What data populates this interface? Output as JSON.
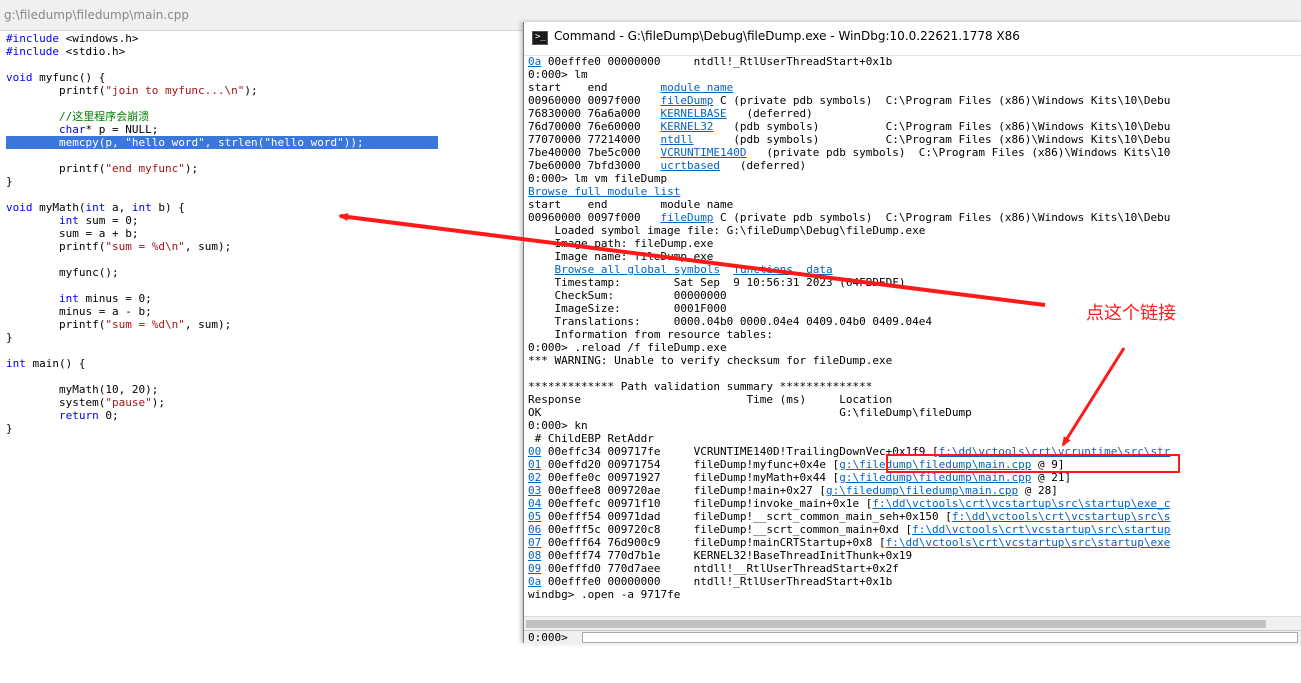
{
  "editor": {
    "title": "g:\\filedump\\filedump\\main.cpp"
  },
  "windbg": {
    "title": "Command - G:\\fileDump\\Debug\\fileDump.exe - WinDbg:10.0.22621.1778 X86",
    "command_prompt": "0:000>",
    "command_value": ""
  },
  "annotation": {
    "text": "点这个链接"
  },
  "colors": {
    "selection": "#3a78dc",
    "keyword": "#0000ff",
    "string": "#a31515",
    "comment": "#008000",
    "link": "#0563c1",
    "annotation": "#ff1a1a"
  },
  "code": [
    [
      {
        "t": "#include ",
        "c": "kw"
      },
      {
        "t": "<windows.h>"
      }
    ],
    [
      {
        "t": "#include ",
        "c": "kw"
      },
      {
        "t": "<stdio.h>"
      }
    ],
    [],
    [
      {
        "t": "void ",
        "c": "kw"
      },
      {
        "t": "myfunc() {"
      }
    ],
    [
      {
        "t": "        printf("
      },
      {
        "t": "\"join to myfunc...\\n\"",
        "c": "st"
      },
      {
        "t": ");"
      }
    ],
    [],
    [
      {
        "t": "        //这里程序会崩溃",
        "c": "cm"
      }
    ],
    [
      {
        "t": "        "
      },
      {
        "t": "char",
        "c": "kw"
      },
      {
        "t": "* p = NULL;"
      }
    ],
    [
      {
        "t": "        memcpy(p, "
      },
      {
        "t": "\"hello word\"",
        "c": "st"
      },
      {
        "t": ", strlen("
      },
      {
        "t": "\"hello word\"",
        "c": "st"
      },
      {
        "t": "));"
      }
    ],
    [],
    [
      {
        "t": "        printf("
      },
      {
        "t": "\"end myfunc\"",
        "c": "st"
      },
      {
        "t": ");"
      }
    ],
    [
      {
        "t": "}"
      }
    ],
    [],
    [
      {
        "t": "void ",
        "c": "kw"
      },
      {
        "t": "myMath("
      },
      {
        "t": "int",
        "c": "kw"
      },
      {
        "t": " a, "
      },
      {
        "t": "int",
        "c": "kw"
      },
      {
        "t": " b) {"
      }
    ],
    [
      {
        "t": "        "
      },
      {
        "t": "int",
        "c": "kw"
      },
      {
        "t": " sum = 0;"
      }
    ],
    [
      {
        "t": "        sum = a + b;"
      }
    ],
    [
      {
        "t": "        printf("
      },
      {
        "t": "\"sum = %d\\n\"",
        "c": "st"
      },
      {
        "t": ", sum);"
      }
    ],
    [],
    [
      {
        "t": "        myfunc();"
      }
    ],
    [],
    [
      {
        "t": "        "
      },
      {
        "t": "int",
        "c": "kw"
      },
      {
        "t": " minus = 0;"
      }
    ],
    [
      {
        "t": "        minus = a - b;"
      }
    ],
    [
      {
        "t": "        printf("
      },
      {
        "t": "\"sum = %d\\n\"",
        "c": "st"
      },
      {
        "t": ", sum);"
      }
    ],
    [
      {
        "t": "}"
      }
    ],
    [],
    [
      {
        "t": "int",
        "c": "kw"
      },
      {
        "t": " main() {"
      }
    ],
    [],
    [
      {
        "t": "        myMath(10, 20);"
      }
    ],
    [
      {
        "t": "        system("
      },
      {
        "t": "\"pause\"",
        "c": "st"
      },
      {
        "t": ");"
      }
    ],
    [
      {
        "t": "        "
      },
      {
        "t": "return",
        "c": "kw"
      },
      {
        "t": " 0;"
      }
    ],
    [
      {
        "t": "}"
      }
    ]
  ],
  "selected_line": 8,
  "output": [
    [
      {
        "t": "0a",
        "c": "lk"
      },
      {
        "t": " 00efffe0 00000000     ntdll!_RtlUserThreadStart+0x1b"
      }
    ],
    [
      {
        "t": "0:000> lm"
      }
    ],
    [
      {
        "t": "start    end        "
      },
      {
        "t": "module name",
        "c": "lk"
      }
    ],
    [
      {
        "t": "00960000 0097f000   "
      },
      {
        "t": "fileDump",
        "c": "lk"
      },
      {
        "t": " C (private pdb symbols)  C:\\Program Files (x86)\\Windows Kits\\10\\Debu"
      }
    ],
    [
      {
        "t": "76830000 76a6a000   "
      },
      {
        "t": "KERNELBASE",
        "c": "lk"
      },
      {
        "t": "   (deferred)"
      }
    ],
    [
      {
        "t": "76d70000 76e60000   "
      },
      {
        "t": "KERNEL32",
        "c": "lk"
      },
      {
        "t": "   (pdb symbols)          C:\\Program Files (x86)\\Windows Kits\\10\\Debu"
      }
    ],
    [
      {
        "t": "77070000 77214000   "
      },
      {
        "t": "ntdll",
        "c": "lk"
      },
      {
        "t": "      (pdb symbols)          C:\\Program Files (x86)\\Windows Kits\\10\\Debu"
      }
    ],
    [
      {
        "t": "7be40000 7be5c000   "
      },
      {
        "t": "VCRUNTIME140D",
        "c": "lk"
      },
      {
        "t": "   (private pdb symbols)  C:\\Program Files (x86)\\Windows Kits\\10"
      }
    ],
    [
      {
        "t": "7be60000 7bfd3000   "
      },
      {
        "t": "ucrtbased",
        "c": "lk"
      },
      {
        "t": "   (deferred)"
      }
    ],
    [
      {
        "t": "0:000> lm vm fileDump"
      }
    ],
    [
      {
        "t": "Browse full module list",
        "c": "lk"
      }
    ],
    [
      {
        "t": "start    end        module name"
      }
    ],
    [
      {
        "t": "00960000 0097f000   "
      },
      {
        "t": "fileDump",
        "c": "lk"
      },
      {
        "t": " C (private pdb symbols)  C:\\Program Files (x86)\\Windows Kits\\10\\Debu"
      }
    ],
    [
      {
        "t": "    Loaded symbol image file: G:\\fileDump\\Debug\\fileDump.exe"
      }
    ],
    [
      {
        "t": "    Image path: fileDump.exe"
      }
    ],
    [
      {
        "t": "    Image name: fileDump.exe"
      }
    ],
    [
      {
        "t": "    "
      },
      {
        "t": "Browse all global symbols",
        "c": "lk"
      },
      {
        "t": "  "
      },
      {
        "t": "functions",
        "c": "lk"
      },
      {
        "t": "  "
      },
      {
        "t": "data",
        "c": "lk"
      }
    ],
    [
      {
        "t": "    Timestamp:        Sat Sep  9 10:56:31 2023 (64FBDEDF)"
      }
    ],
    [
      {
        "t": "    CheckSum:         00000000"
      }
    ],
    [
      {
        "t": "    ImageSize:        0001F000"
      }
    ],
    [
      {
        "t": "    Translations:     0000.04b0 0000.04e4 0409.04b0 0409.04e4"
      }
    ],
    [
      {
        "t": "    Information from resource tables:"
      }
    ],
    [
      {
        "t": "0:000> .reload /f fileDump.exe"
      }
    ],
    [
      {
        "t": "*** WARNING: Unable to verify checksum for fileDump.exe"
      }
    ],
    [],
    [
      {
        "t": "************* Path validation summary **************"
      }
    ],
    [
      {
        "t": "Response                         Time (ms)     Location"
      }
    ],
    [
      {
        "t": "OK                                             G:\\fileDump\\fileDump"
      }
    ],
    [
      {
        "t": "0:000> kn"
      }
    ],
    [
      {
        "t": " # ChildEBP RetAddr"
      }
    ],
    [
      {
        "t": "00",
        "c": "lk"
      },
      {
        "t": " 00effc34 009717fe     VCRUNTIME140D!TrailingDownVec+0x1f9 ["
      },
      {
        "t": "f:\\dd\\vctools\\crt\\vcruntime\\src\\str",
        "c": "lk"
      }
    ],
    [
      {
        "t": "01",
        "c": "lk"
      },
      {
        "t": " 00effd20 00971754     fileDump!myfunc+0x4e ["
      },
      {
        "t": "g:\\filedump\\filedump\\main.cpp",
        "c": "lk"
      },
      {
        "t": " @ 9]"
      }
    ],
    [
      {
        "t": "02",
        "c": "lk"
      },
      {
        "t": " 00effe0c 00971927     fileDump!myMath+0x44 ["
      },
      {
        "t": "g:\\filedump\\filedump\\main.cpp",
        "c": "lk"
      },
      {
        "t": " @ 21]"
      }
    ],
    [
      {
        "t": "03",
        "c": "lk"
      },
      {
        "t": " 00effee8 009720ae     fileDump!main+0x27 ["
      },
      {
        "t": "g:\\filedump\\filedump\\main.cpp",
        "c": "lk"
      },
      {
        "t": " @ 28]"
      }
    ],
    [
      {
        "t": "04",
        "c": "lk"
      },
      {
        "t": " 00effefc 00971f10     fileDump!invoke_main+0x1e ["
      },
      {
        "t": "f:\\dd\\vctools\\crt\\vcstartup\\src\\startup\\exe_c",
        "c": "lk"
      }
    ],
    [
      {
        "t": "05",
        "c": "lk"
      },
      {
        "t": " 00efff54 00971dad     fileDump!__scrt_common_main_seh+0x150 ["
      },
      {
        "t": "f:\\dd\\vctools\\crt\\vcstartup\\src\\s",
        "c": "lk"
      }
    ],
    [
      {
        "t": "06",
        "c": "lk"
      },
      {
        "t": " 00efff5c 009720c8     fileDump!__scrt_common_main+0xd ["
      },
      {
        "t": "f:\\dd\\vctools\\crt\\vcstartup\\src\\startup",
        "c": "lk"
      }
    ],
    [
      {
        "t": "07",
        "c": "lk"
      },
      {
        "t": " 00efff64 76d900c9     fileDump!mainCRTStartup+0x8 ["
      },
      {
        "t": "f:\\dd\\vctools\\crt\\vcstartup\\src\\startup\\exe",
        "c": "lk"
      }
    ],
    [
      {
        "t": "08",
        "c": "lk"
      },
      {
        "t": " 00efff74 770d7b1e     KERNEL32!BaseThreadInitThunk+0x19"
      }
    ],
    [
      {
        "t": "09",
        "c": "lk"
      },
      {
        "t": " 00efffd0 770d7aee     ntdll!__RtlUserThreadStart+0x2f"
      }
    ],
    [
      {
        "t": "0a",
        "c": "lk"
      },
      {
        "t": " 00efffe0 00000000     ntdll!_RtlUserThreadStart+0x1b"
      }
    ],
    [
      {
        "t": "windbg> .open -a 9717fe"
      }
    ]
  ]
}
